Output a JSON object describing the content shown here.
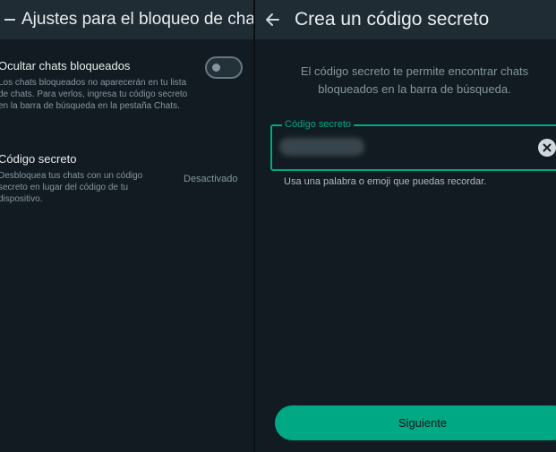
{
  "left_screen": {
    "header": {
      "back_icon": "arrow-left-icon",
      "title": "Ajustes para el bloqueo de cha..."
    },
    "hide_locked_chats": {
      "title": "Ocultar chats bloqueados",
      "description": "Los chats bloqueados no aparecerán en tu lista de chats. Para verlos, ingresa tu código secreto en la barra de búsqueda en la pestaña Chats.",
      "enabled": false
    },
    "secret_code": {
      "title": "Código secreto",
      "description": "Desbloquea tus chats con un código secreto en lugar del código de tu dispositivo.",
      "status": "Desactivado"
    }
  },
  "right_screen": {
    "header": {
      "back_icon": "arrow-left-icon",
      "title": "Crea un código secreto"
    },
    "intro": "El código secreto te permite encontrar chats bloqueados en la barra de búsqueda.",
    "code_field": {
      "label": "Código secreto",
      "value_hidden": true,
      "clear_icon": "clear-icon"
    },
    "helper_text": "Usa una palabra o emoji que puedas recordar.",
    "next_button": "Siguiente"
  },
  "colors": {
    "background": "#111b21",
    "header": "#1f2c34",
    "accent": "#00a884",
    "secondary_text": "#8696a0",
    "primary_text": "#e9edef"
  }
}
